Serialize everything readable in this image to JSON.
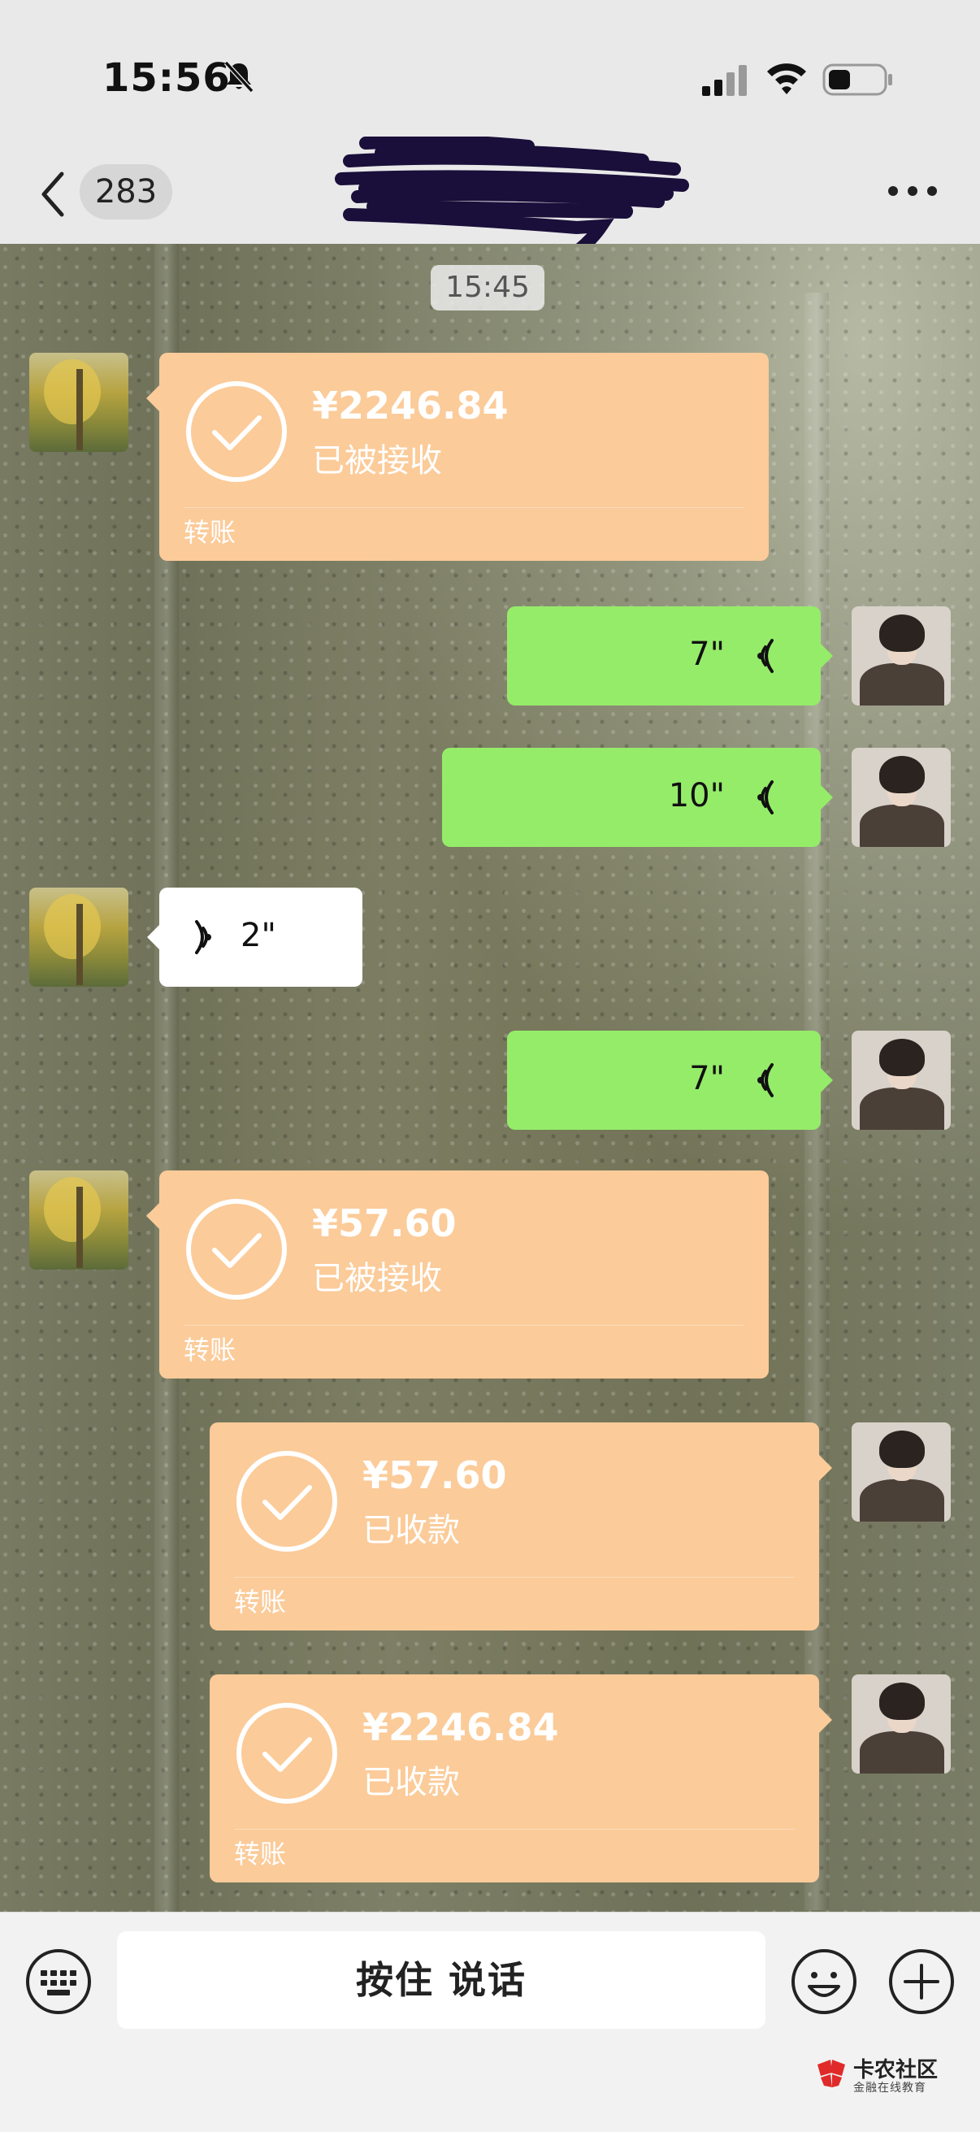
{
  "status_bar": {
    "time": "15:56",
    "icons": [
      "bell-slash-icon",
      "signal-icon",
      "wifi-icon",
      "battery-icon"
    ]
  },
  "nav": {
    "back_icon": "chevron-left-icon",
    "unread_count": "283",
    "more_icon": "more-horizontal-icon"
  },
  "chat": {
    "timestamp": "15:45",
    "messages": [
      {
        "type": "transfer",
        "side": "left",
        "amount": "¥2246.84",
        "status": "已被接收",
        "label": "转账"
      },
      {
        "type": "voice",
        "side": "right",
        "duration": "7\""
      },
      {
        "type": "voice",
        "side": "right",
        "duration": "10\""
      },
      {
        "type": "voice",
        "side": "left",
        "duration": "2\""
      },
      {
        "type": "voice",
        "side": "right",
        "duration": "7\""
      },
      {
        "type": "transfer",
        "side": "left",
        "amount": "¥57.60",
        "status": "已被接收",
        "label": "转账"
      },
      {
        "type": "transfer",
        "side": "right",
        "amount": "¥57.60",
        "status": "已收款",
        "label": "转账"
      },
      {
        "type": "transfer",
        "side": "right",
        "amount": "¥2246.84",
        "status": "已收款",
        "label": "转账"
      }
    ]
  },
  "input_bar": {
    "hold_to_talk": "按住 说话",
    "icons": [
      "keyboard-icon",
      "emoji-icon",
      "plus-icon"
    ]
  },
  "watermark": {
    "name": "卡农社区",
    "subtitle": "金融在线教育"
  },
  "colors": {
    "transfer_bubble": "#fbcb99",
    "voice_sent": "#95ec69",
    "voice_received": "#ffffff"
  }
}
